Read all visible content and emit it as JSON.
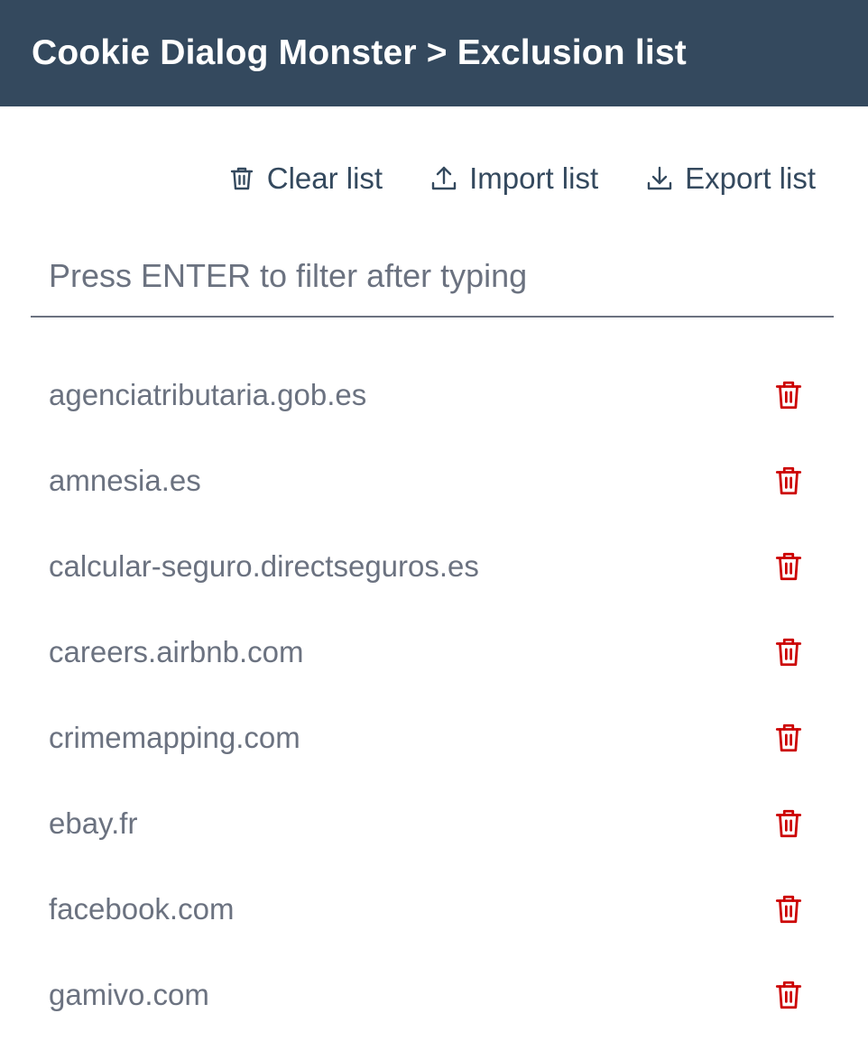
{
  "header": {
    "title": "Cookie Dialog Monster > Exclusion list"
  },
  "toolbar": {
    "clear_label": "Clear list",
    "clear_icon": "trash-icon",
    "import_label": "Import list",
    "import_icon": "upload-icon",
    "export_label": "Export list",
    "export_icon": "download-icon"
  },
  "filter": {
    "placeholder": "Press ENTER to filter after typing",
    "value": ""
  },
  "domains": [
    "agenciatributaria.gob.es",
    "amnesia.es",
    "calcular-seguro.directseguros.es",
    "careers.airbnb.com",
    "crimemapping.com",
    "ebay.fr",
    "facebook.com",
    "gamivo.com"
  ],
  "row_action_icon": "trash-icon",
  "colors": {
    "header_bg": "#34495e",
    "header_text": "#ffffff",
    "toolbar_text": "#34495e",
    "domain_text": "#6b7280",
    "delete_icon": "#cc0000",
    "divider": "#6b7280"
  }
}
